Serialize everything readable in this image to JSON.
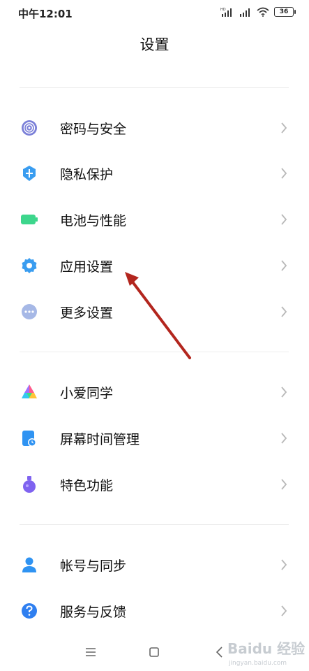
{
  "status_bar": {
    "time": "中午12:01",
    "battery": "36",
    "icons": [
      "hd-signal-icon",
      "signal-icon",
      "wifi-icon",
      "battery-icon"
    ]
  },
  "header": {
    "title": "设置"
  },
  "groups": [
    {
      "items": [
        {
          "label": "密码与安全",
          "icon": "fingerprint-icon",
          "color": "#7b80d8"
        },
        {
          "label": "隐私保护",
          "icon": "privacy-shield-icon",
          "color": "#3a9df0"
        },
        {
          "label": "电池与性能",
          "icon": "battery-icon",
          "color": "#3dd68c"
        },
        {
          "label": "应用设置",
          "icon": "gear-icon",
          "color": "#3a9df0"
        },
        {
          "label": "更多设置",
          "icon": "more-dots-icon",
          "color": "#a6b8e6"
        }
      ]
    },
    {
      "items": [
        {
          "label": "小爱同学",
          "icon": "xiaoai-icon",
          "color": "#7a5cff"
        },
        {
          "label": "屏幕时间管理",
          "icon": "screen-time-icon",
          "color": "#2f93f2"
        },
        {
          "label": "特色功能",
          "icon": "flask-icon",
          "color": "#7f63f0"
        }
      ]
    },
    {
      "items": [
        {
          "label": "帐号与同步",
          "icon": "person-icon",
          "color": "#2f93f2"
        },
        {
          "label": "服务与反馈",
          "icon": "help-icon",
          "color": "#2f7ff0"
        }
      ]
    }
  ],
  "nav_bar": {
    "buttons": [
      "menu-icon",
      "home-icon",
      "back-icon"
    ]
  },
  "watermark": {
    "text": "Baidu 经验",
    "url": "jingyan.baidu.com"
  }
}
